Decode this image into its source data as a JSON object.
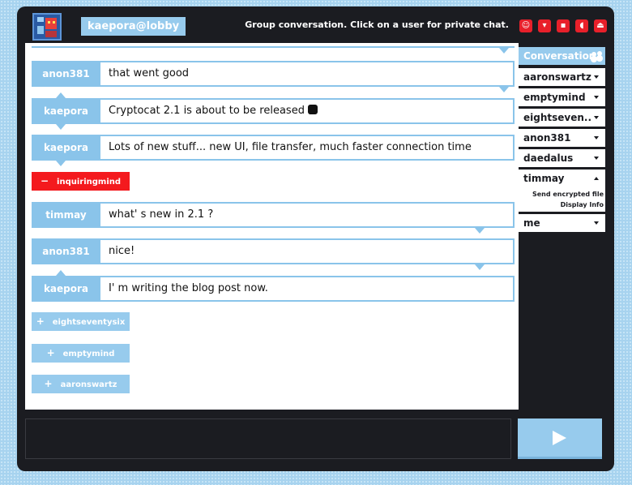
{
  "header": {
    "nick": "kaepora@lobby",
    "status": "Group conversation. Click on a user for private chat."
  },
  "top_icons": [
    "smiley-icon",
    "filter-icon",
    "chat-icon",
    "sound-icon",
    "logout-icon"
  ],
  "messages": [
    {
      "nick": "anon381",
      "text": "that went good"
    },
    {
      "nick": "kaepora",
      "text": "Cryptocat 2.1 is about to be released",
      "emoticon": "cat-icon"
    },
    {
      "nick": "kaepora",
      "text": "Lots of new stuff... new UI, file transfer, much faster connection time"
    },
    {
      "nick": "timmay",
      "text": "what' s new in 2.1 ?"
    },
    {
      "nick": "anon381",
      "text": "nice!"
    },
    {
      "nick": "kaepora",
      "text": "I' m writing the blog post now."
    }
  ],
  "status_chips": [
    {
      "sign": "−",
      "nick": "inquiringmind",
      "kind": "left",
      "color": "#f41a1e"
    },
    {
      "sign": "+",
      "nick": "eightseventysix",
      "kind": "joined",
      "color": "#97cbed"
    },
    {
      "sign": "+",
      "nick": "emptymind",
      "kind": "joined",
      "color": "#97cbed"
    },
    {
      "sign": "+",
      "nick": "aaronswartz",
      "kind": "joined",
      "color": "#97cbed"
    }
  ],
  "buddy_list": {
    "header": "Conversation",
    "buddies": [
      {
        "name": "aaronswartz",
        "expanded": false
      },
      {
        "name": "emptymind",
        "expanded": false
      },
      {
        "name": "eightseven..",
        "expanded": false
      },
      {
        "name": "anon381",
        "expanded": false
      },
      {
        "name": "daedalus",
        "expanded": false
      },
      {
        "name": "timmay",
        "expanded": true,
        "menu": [
          "Send encrypted file",
          "Display Info"
        ]
      },
      {
        "name": "me",
        "expanded": false
      }
    ]
  },
  "input": {
    "value": "",
    "placeholder": ""
  },
  "colors": {
    "accent": "#97cbed",
    "dark": "#1b1c21",
    "alert": "#f41a1e"
  }
}
